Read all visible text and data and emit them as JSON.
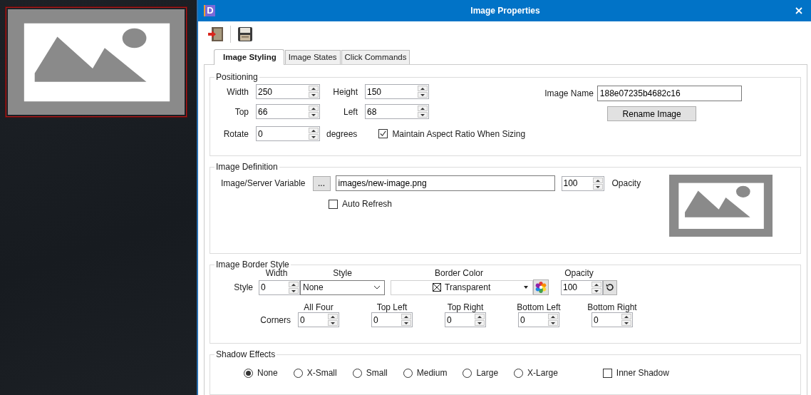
{
  "canvas": {
    "selected": true
  },
  "window": {
    "logo": "D",
    "title": "Image Properties"
  },
  "tabs": [
    {
      "label": "Image Styling",
      "selected": true
    },
    {
      "label": "Image States",
      "selected": false
    },
    {
      "label": "Click Commands",
      "selected": false
    }
  ],
  "positioning": {
    "title": "Positioning",
    "fields": [
      {
        "label": "Width",
        "value": "250"
      },
      {
        "label": "Height",
        "value": "150"
      },
      {
        "label": "Top",
        "value": "66"
      },
      {
        "label": "Left",
        "value": "68"
      }
    ],
    "rotate": {
      "label": "Rotate",
      "value": "0",
      "unit": "degrees"
    },
    "maintain_aspect": {
      "label": "Maintain Aspect Ratio When Sizing",
      "checked": true
    },
    "image_name": {
      "label": "Image Name",
      "value": "188e07235b4682c16"
    },
    "rename_button": "Rename Image"
  },
  "image_definition": {
    "title": "Image Definition",
    "variable_label": "Image/Server Variable",
    "browse_button": "...",
    "path": "images/new-image.png",
    "opacity": "100",
    "opacity_label": "Opacity",
    "auto_refresh": {
      "label": "Auto Refresh",
      "checked": false
    }
  },
  "border_style": {
    "title": "Image Border Style",
    "row_label": "Style",
    "width": {
      "label": "Width",
      "value": "0"
    },
    "style": {
      "label": "Style",
      "value": "None"
    },
    "border_color": {
      "label": "Border Color",
      "value": "Transparent"
    },
    "opacity": {
      "label": "Opacity",
      "value": "100"
    },
    "corners_label": "Corners",
    "corners": [
      {
        "label": "All Four",
        "value": "0"
      },
      {
        "label": "Top Left",
        "value": "0"
      },
      {
        "label": "Top Right",
        "value": "0"
      },
      {
        "label": "Bottom Left",
        "value": "0"
      },
      {
        "label": "Bottom Right",
        "value": "0"
      }
    ]
  },
  "shadow_effects": {
    "title": "Shadow Effects",
    "options": [
      {
        "label": "None",
        "selected": true
      },
      {
        "label": "X-Small",
        "selected": false
      },
      {
        "label": "Small",
        "selected": false
      },
      {
        "label": "Medium",
        "selected": false
      },
      {
        "label": "Large",
        "selected": false
      },
      {
        "label": "X-Large",
        "selected": false
      }
    ],
    "inner_shadow": {
      "label": "Inner Shadow",
      "checked": false
    }
  }
}
